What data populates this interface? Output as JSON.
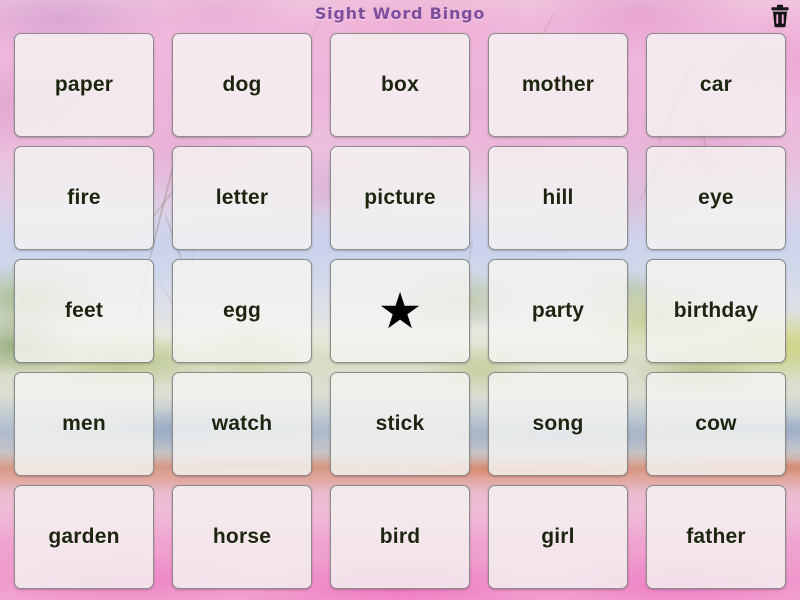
{
  "app": {
    "title": "Sight Word Bingo",
    "accent_color": "#7d4f9e",
    "card_text_color": "#1d2410",
    "card_fill_color": "#f4f4f2",
    "card_border_color": "#8c8c8c"
  },
  "header": {
    "title": "Sight Word Bingo",
    "trash": {
      "icon": "trash-icon",
      "label": "Clear board",
      "color": "#1a1a1a"
    }
  },
  "board": {
    "rows": 5,
    "columns": 5,
    "free_space": {
      "row": 3,
      "column": 3,
      "glyph": "★",
      "name": "free-space-star"
    },
    "cells": [
      [
        {
          "word": "paper",
          "marked": false
        },
        {
          "word": "dog",
          "marked": false
        },
        {
          "word": "box",
          "marked": false
        },
        {
          "word": "mother",
          "marked": false
        },
        {
          "word": "car",
          "marked": false
        }
      ],
      [
        {
          "word": "fire",
          "marked": false
        },
        {
          "word": "letter",
          "marked": false
        },
        {
          "word": "picture",
          "marked": false
        },
        {
          "word": "hill",
          "marked": false
        },
        {
          "word": "eye",
          "marked": false
        }
      ],
      [
        {
          "word": "feet",
          "marked": false
        },
        {
          "word": "egg",
          "marked": false
        },
        {
          "word": "★",
          "marked": false,
          "free": true
        },
        {
          "word": "party",
          "marked": false
        },
        {
          "word": "birthday",
          "marked": false
        }
      ],
      [
        {
          "word": "men",
          "marked": false
        },
        {
          "word": "watch",
          "marked": false
        },
        {
          "word": "stick",
          "marked": false
        },
        {
          "word": "song",
          "marked": false
        },
        {
          "word": "cow",
          "marked": false
        }
      ],
      [
        {
          "word": "garden",
          "marked": false
        },
        {
          "word": "horse",
          "marked": false
        },
        {
          "word": "bird",
          "marked": false
        },
        {
          "word": "girl",
          "marked": false
        },
        {
          "word": "father",
          "marked": false
        }
      ]
    ]
  }
}
